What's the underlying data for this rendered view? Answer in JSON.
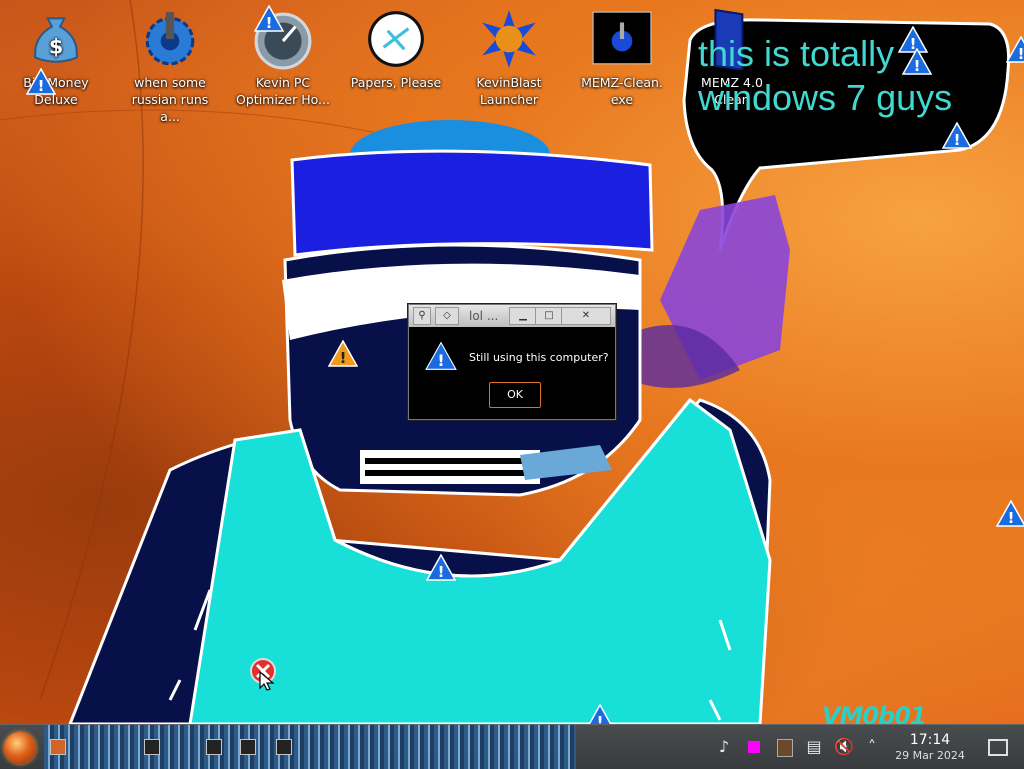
{
  "desktop": {
    "icons": [
      {
        "label": "Big Money Deluxe",
        "icon": "money-bag-icon"
      },
      {
        "label": "when some russian runs a...",
        "icon": "blue-gear-icon"
      },
      {
        "label": "Kevin PC Optimizer Ho...",
        "icon": "gauge-icon"
      },
      {
        "label": "Papers, Please",
        "icon": "papers-please-icon"
      },
      {
        "label": "KevinBlast Launcher",
        "icon": "blast-icon"
      },
      {
        "label": "MEMZ-Clean. exe",
        "icon": "memz-icon"
      },
      {
        "label": "MEMZ 4.0 Clean",
        "icon": "blue-folder-icon"
      }
    ],
    "speech_bubble": "this is totally windows 7 guys",
    "watermark": "VM0b01"
  },
  "dialog": {
    "title": "lol ...",
    "message": "Still using this computer?",
    "ok_label": "OK",
    "icon": "warning-icon"
  },
  "taskbar": {
    "start_icon": "start-orb-icon",
    "clock_time": "17:14",
    "clock_date": "29 Mar 2024",
    "tray_icons": [
      "notifications-icon",
      "color-square-icon",
      "app-icon",
      "clipboard-icon",
      "volume-muted-icon",
      "chevron-up-icon"
    ]
  },
  "colors": {
    "background": "#e8781f",
    "bubble_text": "#40d8d0",
    "taskbar": "#3f4244",
    "ok_border": "#d9732a"
  }
}
